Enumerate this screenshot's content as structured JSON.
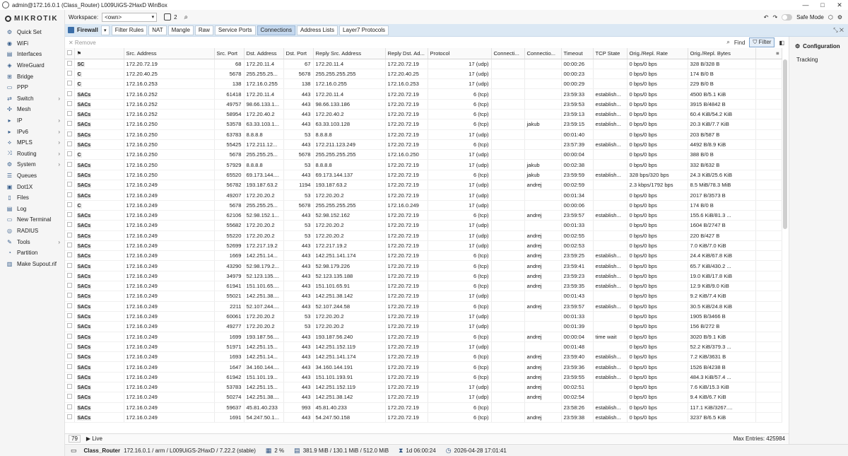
{
  "window": {
    "title": "admin@172.16.0.1 (Class_Router) L009UiGS-2HaxD WinBox",
    "min": "—",
    "max": "□",
    "close": "✕"
  },
  "brand": "MIKROTIK",
  "nav": [
    {
      "label": "Quick Set",
      "icon": "quick-set-icon",
      "glyph": "⚙",
      "chev": ""
    },
    {
      "label": "WiFi",
      "icon": "wifi-icon",
      "glyph": "◉",
      "chev": ""
    },
    {
      "label": "Interfaces",
      "icon": "interfaces-icon",
      "glyph": "▤",
      "chev": ""
    },
    {
      "label": "WireGuard",
      "icon": "wireguard-icon",
      "glyph": "◈",
      "chev": ""
    },
    {
      "label": "Bridge",
      "icon": "bridge-icon",
      "glyph": "⊞",
      "chev": ""
    },
    {
      "label": "PPP",
      "icon": "ppp-icon",
      "glyph": "▭",
      "chev": ""
    },
    {
      "label": "Switch",
      "icon": "switch-icon",
      "glyph": "⇄",
      "chev": "›"
    },
    {
      "label": "Mesh",
      "icon": "mesh-icon",
      "glyph": "✣",
      "chev": ""
    },
    {
      "label": "IP",
      "icon": "ip-icon",
      "glyph": "▸",
      "chev": "›"
    },
    {
      "label": "IPv6",
      "icon": "ipv6-icon",
      "glyph": "▸",
      "chev": "›"
    },
    {
      "label": "MPLS",
      "icon": "mpls-icon",
      "glyph": "⟡",
      "chev": "›"
    },
    {
      "label": "Routing",
      "icon": "routing-icon",
      "glyph": "⤨",
      "chev": "›"
    },
    {
      "label": "System",
      "icon": "system-icon",
      "glyph": "⚙",
      "chev": "›"
    },
    {
      "label": "Queues",
      "icon": "queues-icon",
      "glyph": "☰",
      "chev": ""
    },
    {
      "label": "Dot1X",
      "icon": "dot1x-icon",
      "glyph": "▣",
      "chev": ""
    },
    {
      "label": "Files",
      "icon": "files-icon",
      "glyph": "▯",
      "chev": ""
    },
    {
      "label": "Log",
      "icon": "log-icon",
      "glyph": "▤",
      "chev": ""
    },
    {
      "label": "New Terminal",
      "icon": "terminal-icon",
      "glyph": "▭",
      "chev": ""
    },
    {
      "label": "RADIUS",
      "icon": "radius-icon",
      "glyph": "◎",
      "chev": ""
    },
    {
      "label": "Tools",
      "icon": "tools-icon",
      "glyph": "✎",
      "chev": "›"
    },
    {
      "label": "Partition",
      "icon": "partition-icon",
      "glyph": "◔",
      "chev": ""
    },
    {
      "label": "Make Supout.rif",
      "icon": "supout-icon",
      "glyph": "▥",
      "chev": ""
    }
  ],
  "topbar": {
    "workspace_label": "Workspace:",
    "workspace_value": "<own>",
    "window_count": "2",
    "safe_mode": "Safe Mode"
  },
  "firewall": {
    "title": "Firewall",
    "tabs": [
      "Filter Rules",
      "NAT",
      "Mangle",
      "Raw",
      "Service Ports",
      "Connections",
      "Address Lists",
      "Layer7 Protocols"
    ],
    "active": 5
  },
  "toolbar": {
    "remove": "✕ Remove",
    "find": "Find",
    "filter": "Filter"
  },
  "columns": [
    "",
    "",
    "Src. Address",
    "Src. Port",
    "Dst. Address",
    "Dst. Port",
    "Reply Src. Address",
    "Reply Dst. Ad...",
    "Protocol",
    "Connecti...",
    "Connectio...",
    "Timeout",
    "TCP State",
    "Orig./Repl. Rate",
    "Orig./Repl. Bytes"
  ],
  "rows": [
    [
      "SC",
      "172.20.72.19",
      "68",
      "172.20.11.4",
      "67",
      "172.20.11.4",
      "172.20.72.19",
      "17 (udp)",
      "",
      "",
      "00:00:26",
      "",
      "0 bps/0 bps",
      "328 B/328 B"
    ],
    [
      "C",
      "172.20.40.25",
      "5678",
      "255.255.25...",
      "5678",
      "255.255.255.255",
      "172.20.40.25",
      "17 (udp)",
      "",
      "",
      "00:00:23",
      "",
      "0 bps/0 bps",
      "174 B/0 B"
    ],
    [
      "C",
      "172.16.0.253",
      "138",
      "172.16.0.255",
      "138",
      "172.16.0.255",
      "172.16.0.253",
      "17 (udp)",
      "",
      "",
      "00:00:29",
      "",
      "0 bps/0 bps",
      "229 B/0 B"
    ],
    [
      "SACs",
      "172.16.0.252",
      "61418",
      "172.20.11.4",
      "443",
      "172.20.11.4",
      "172.20.72.19",
      "6 (tcp)",
      "",
      "",
      "23:59:33",
      "establish...",
      "0 bps/0 bps",
      "4500 B/5.1 KiB"
    ],
    [
      "SACs",
      "172.16.0.252",
      "49757",
      "98.66.133.1...",
      "443",
      "98.66.133.186",
      "172.20.72.19",
      "6 (tcp)",
      "",
      "",
      "23:59:53",
      "establish...",
      "0 bps/0 bps",
      "3915 B/4842 B"
    ],
    [
      "SACs",
      "172.16.0.252",
      "58954",
      "172.20.40.2",
      "443",
      "172.20.40.2",
      "172.20.72.19",
      "6 (tcp)",
      "",
      "",
      "23:59:13",
      "establish...",
      "0 bps/0 bps",
      "60.4 KiB/54.2 KiB"
    ],
    [
      "SACs",
      "172.16.0.250",
      "53578",
      "63.33.103.1...",
      "443",
      "63.33.103.128",
      "172.20.72.19",
      "6 (tcp)",
      "",
      "jakub",
      "23:59:15",
      "establish...",
      "0 bps/0 bps",
      "20.3 KiB/7.7 KiB"
    ],
    [
      "SACs",
      "172.16.0.250",
      "63783",
      "8.8.8.8",
      "53",
      "8.8.8.8",
      "172.20.72.19",
      "17 (udp)",
      "",
      "",
      "00:01:40",
      "",
      "0 bps/0 bps",
      "203 B/587 B"
    ],
    [
      "SACs",
      "172.16.0.250",
      "55425",
      "172.211.12...",
      "443",
      "172.211.123.249",
      "172.20.72.19",
      "6 (tcp)",
      "",
      "",
      "23:57:39",
      "establish...",
      "0 bps/0 bps",
      "4492 B/8.9 KiB"
    ],
    [
      "C",
      "172.16.0.250",
      "5678",
      "255.255.25...",
      "5678",
      "255.255.255.255",
      "172.16.0.250",
      "17 (udp)",
      "",
      "",
      "00:00:04",
      "",
      "0 bps/0 bps",
      "388 B/0 B"
    ],
    [
      "SACs",
      "172.16.0.250",
      "57929",
      "8.8.8.8",
      "53",
      "8.8.8.8",
      "172.20.72.19",
      "17 (udp)",
      "",
      "jakub",
      "00:02:38",
      "",
      "0 bps/0 bps",
      "332 B/632 B"
    ],
    [
      "SACs",
      "172.16.0.250",
      "65520",
      "69.173.144....",
      "443",
      "69.173.144.137",
      "172.20.72.19",
      "6 (tcp)",
      "",
      "jakub",
      "23:59:59",
      "establish...",
      "328 bps/320 bps",
      "24.3 KiB/25.6 KiB"
    ],
    [
      "SACs",
      "172.16.0.249",
      "56782",
      "193.187.63.2",
      "1194",
      "193.187.63.2",
      "172.20.72.19",
      "17 (udp)",
      "",
      "andrej",
      "00:02:59",
      "",
      "2.3 kbps/1792 bps",
      "8.5 MiB/78.3 MiB"
    ],
    [
      "SACs",
      "172.16.0.249",
      "49207",
      "172.20.20.2",
      "53",
      "172.20.20.2",
      "172.20.72.19",
      "17 (udp)",
      "",
      "",
      "00:01:34",
      "",
      "0 bps/0 bps",
      "2017 B/3573 B"
    ],
    [
      "C",
      "172.16.0.249",
      "5678",
      "255.255.25...",
      "5678",
      "255.255.255.255",
      "172.16.0.249",
      "17 (udp)",
      "",
      "",
      "00:00:06",
      "",
      "0 bps/0 bps",
      "174 B/0 B"
    ],
    [
      "SACs",
      "172.16.0.249",
      "62106",
      "52.98.152.1...",
      "443",
      "52.98.152.162",
      "172.20.72.19",
      "6 (tcp)",
      "",
      "andrej",
      "23:59:57",
      "establish...",
      "0 bps/0 bps",
      "155.6 KiB/81.3 ..."
    ],
    [
      "SACs",
      "172.16.0.249",
      "55682",
      "172.20.20.2",
      "53",
      "172.20.20.2",
      "172.20.72.19",
      "17 (udp)",
      "",
      "",
      "00:01:33",
      "",
      "0 bps/0 bps",
      "1604 B/2747 B"
    ],
    [
      "SACs",
      "172.16.0.249",
      "55220",
      "172.20.20.2",
      "53",
      "172.20.20.2",
      "172.20.72.19",
      "17 (udp)",
      "",
      "andrej",
      "00:02:55",
      "",
      "0 bps/0 bps",
      "220 B/427 B"
    ],
    [
      "SACs",
      "172.16.0.249",
      "52699",
      "172.217.19.2",
      "443",
      "172.217.19.2",
      "172.20.72.19",
      "17 (udp)",
      "",
      "andrej",
      "00:02:53",
      "",
      "0 bps/0 bps",
      "7.0 KiB/7.0 KiB"
    ],
    [
      "SACs",
      "172.16.0.249",
      "1669",
      "142.251.14...",
      "443",
      "142.251.141.174",
      "172.20.72.19",
      "6 (tcp)",
      "",
      "andrej",
      "23:59:25",
      "establish...",
      "0 bps/0 bps",
      "24.4 KiB/67.8 KiB"
    ],
    [
      "SACs",
      "172.16.0.249",
      "43290",
      "52.98.179.2...",
      "443",
      "52.98.179.226",
      "172.20.72.19",
      "6 (tcp)",
      "",
      "andrej",
      "23:59:41",
      "establish...",
      "0 bps/0 bps",
      "65.7 KiB/430.2 ..."
    ],
    [
      "SACs",
      "172.16.0.249",
      "34979",
      "52.123.135....",
      "443",
      "52.123.135.188",
      "172.20.72.19",
      "6 (tcp)",
      "",
      "andrej",
      "23:59:23",
      "establish...",
      "0 bps/0 bps",
      "19.0 KiB/17.8 KiB"
    ],
    [
      "SACs",
      "172.16.0.249",
      "61941",
      "151.101.65....",
      "443",
      "151.101.65.91",
      "172.20.72.19",
      "6 (tcp)",
      "",
      "andrej",
      "23:59:35",
      "establish...",
      "0 bps/0 bps",
      "12.9 KiB/9.0 KiB"
    ],
    [
      "SACs",
      "172.16.0.249",
      "55021",
      "142.251.38....",
      "443",
      "142.251.38.142",
      "172.20.72.19",
      "17 (udp)",
      "",
      "",
      "00:01:43",
      "",
      "0 bps/0 bps",
      "9.2 KiB/7.4 KiB"
    ],
    [
      "SACs",
      "172.16.0.249",
      "2211",
      "52.107.244....",
      "443",
      "52.107.244.58",
      "172.20.72.19",
      "6 (tcp)",
      "",
      "andrej",
      "23:59:57",
      "establish...",
      "0 bps/0 bps",
      "30.5 KiB/24.8 KiB"
    ],
    [
      "SACs",
      "172.16.0.249",
      "60061",
      "172.20.20.2",
      "53",
      "172.20.20.2",
      "172.20.72.19",
      "17 (udp)",
      "",
      "",
      "00:01:33",
      "",
      "0 bps/0 bps",
      "1905 B/3466 B"
    ],
    [
      "SACs",
      "172.16.0.249",
      "49277",
      "172.20.20.2",
      "53",
      "172.20.20.2",
      "172.20.72.19",
      "17 (udp)",
      "",
      "",
      "00:01:39",
      "",
      "0 bps/0 bps",
      "156 B/272 B"
    ],
    [
      "SACs",
      "172.16.0.249",
      "1699",
      "193.187.56....",
      "443",
      "193.187.56.240",
      "172.20.72.19",
      "6 (tcp)",
      "",
      "andrej",
      "00:00:04",
      "time wait",
      "0 bps/0 bps",
      "3020 B/9.1 KiB"
    ],
    [
      "SACs",
      "172.16.0.249",
      "51971",
      "142.251.15...",
      "443",
      "142.251.152.119",
      "172.20.72.19",
      "17 (udp)",
      "",
      "",
      "00:01:48",
      "",
      "0 bps/0 bps",
      "52.2 KiB/379.3 ..."
    ],
    [
      "SACs",
      "172.16.0.249",
      "1693",
      "142.251.14...",
      "443",
      "142.251.141.174",
      "172.20.72.19",
      "6 (tcp)",
      "",
      "andrej",
      "23:59:40",
      "establish...",
      "0 bps/0 bps",
      "7.2 KiB/3631 B"
    ],
    [
      "SACs",
      "172.16.0.249",
      "1647",
      "34.160.144....",
      "443",
      "34.160.144.191",
      "172.20.72.19",
      "6 (tcp)",
      "",
      "andrej",
      "23:59:36",
      "establish...",
      "0 bps/0 bps",
      "1526 B/4238 B"
    ],
    [
      "SACs",
      "172.16.0.249",
      "61942",
      "151.101.19...",
      "443",
      "151.101.193.91",
      "172.20.72.19",
      "6 (tcp)",
      "",
      "andrej",
      "23:59:55",
      "establish...",
      "0 bps/0 bps",
      "484.3 KiB/57.4 ..."
    ],
    [
      "SACs",
      "172.16.0.249",
      "53783",
      "142.251.15...",
      "443",
      "142.251.152.119",
      "172.20.72.19",
      "17 (udp)",
      "",
      "andrej",
      "00:02:51",
      "",
      "0 bps/0 bps",
      "7.6 KiB/15.3 KiB"
    ],
    [
      "SACs",
      "172.16.0.249",
      "50274",
      "142.251.38....",
      "443",
      "142.251.38.142",
      "172.20.72.19",
      "17 (udp)",
      "",
      "andrej",
      "00:02:54",
      "",
      "0 bps/0 bps",
      "9.4 KiB/6.7 KiB"
    ],
    [
      "SACs",
      "172.16.0.249",
      "59637",
      "45.81.40.233",
      "993",
      "45.81.40.233",
      "172.20.72.19",
      "6 (tcp)",
      "",
      "",
      "23:58:26",
      "establish...",
      "0 bps/0 bps",
      "117.1 KiB/3267...."
    ],
    [
      "SACs",
      "172.16.0.249",
      "1691",
      "54.247.50.1...",
      "443",
      "54.247.50.158",
      "172.20.72.19",
      "6 (tcp)",
      "",
      "andrej",
      "23:59:38",
      "establish...",
      "0 bps/0 bps",
      "3237 B/6.5 KiB"
    ]
  ],
  "bottom": {
    "count": "79",
    "live": "▶ Live",
    "max": "Max Entries: 425984"
  },
  "status": {
    "name": "Class_Router",
    "path": "172.16.0.1 / arm / L009UiGS-2HaxD / 7.22.2 (stable)",
    "cpu": "2 %",
    "mem": "381.9 MiB / 130.1 MiB / 512.0 MiB",
    "uptime": "1d 06:00:24",
    "date": "2026-04-28 17:01:41"
  },
  "right": {
    "title": "Configuration",
    "item": "Tracking"
  }
}
